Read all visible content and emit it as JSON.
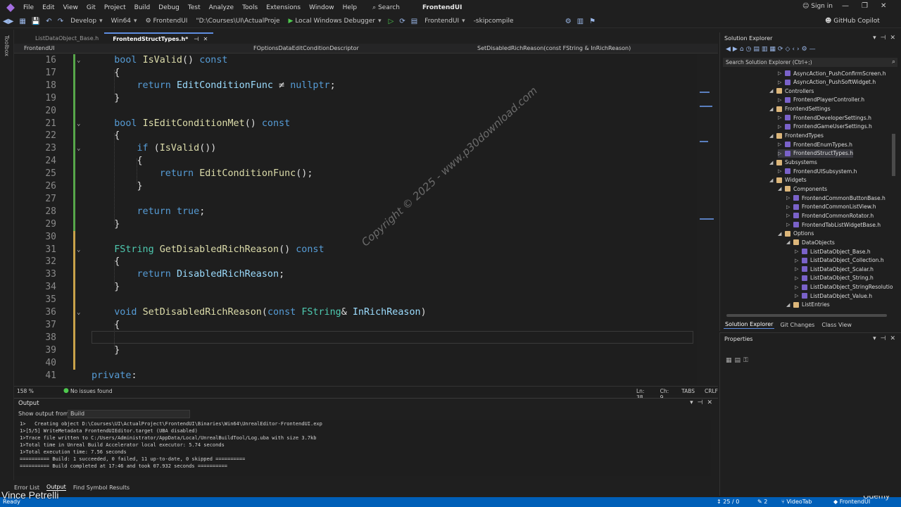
{
  "menu": {
    "items": [
      "File",
      "Edit",
      "View",
      "Git",
      "Project",
      "Build",
      "Debug",
      "Test",
      "Analyze",
      "Tools",
      "Extensions",
      "Window",
      "Help"
    ],
    "search_label": "Search",
    "solution_name": "FrontendUI",
    "sign_in": "Sign in"
  },
  "toolbar": {
    "config": "Develop",
    "platform": "Win64",
    "startup_project": "FrontendUI",
    "path": "\"D:\\Courses\\UI\\ActualProje",
    "debugger": "Local Windows Debugger",
    "target": "FrontendUI",
    "args": "-skipcompile",
    "copilot": "GitHub Copilot"
  },
  "toolbox_label": "Toolbox",
  "tabs": [
    {
      "label": "ListDataObject_Base.h",
      "active": false
    },
    {
      "label": "FrontendStructTypes.h*",
      "active": true
    }
  ],
  "navbar": {
    "project": "FrontendUI",
    "scope": "FOptionsDataEditConditionDescriptor",
    "member": "SetDisabledRichReason(const FString & InRichReason)"
  },
  "code_lines": [
    {
      "n": "16",
      "html": "    <span class=\"kw\">bool</span> <span class=\"fn\">IsValid</span>() <span class=\"kw\">const</span>",
      "fold": "⌄",
      "chg": "g"
    },
    {
      "n": "17",
      "html": "    {",
      "chg": "g"
    },
    {
      "n": "18",
      "html": "        <span class=\"kw\">return</span> <span class=\"pm\">EditConditionFunc</span> ≠ <span class=\"kw\">nullptr</span>;",
      "chg": "g"
    },
    {
      "n": "19",
      "html": "    }",
      "chg": "g"
    },
    {
      "n": "20",
      "html": "",
      "chg": "g"
    },
    {
      "n": "21",
      "html": "    <span class=\"kw\">bool</span> <span class=\"fn\">IsEditConditionMet</span>() <span class=\"kw\">const</span>",
      "fold": "⌄",
      "chg": "g"
    },
    {
      "n": "22",
      "html": "    {",
      "chg": "g"
    },
    {
      "n": "23",
      "html": "        <span class=\"kw\">if</span> (<span class=\"fn\">IsValid</span>())",
      "fold": "⌄",
      "chg": "g"
    },
    {
      "n": "24",
      "html": "        {",
      "chg": "g"
    },
    {
      "n": "25",
      "html": "            <span class=\"kw\">return</span> <span class=\"fn\">EditConditionFunc</span>();",
      "chg": "g"
    },
    {
      "n": "26",
      "html": "        }",
      "chg": "g"
    },
    {
      "n": "27",
      "html": "",
      "chg": "g"
    },
    {
      "n": "28",
      "html": "        <span class=\"kw\">return</span> <span class=\"kw\">true</span>;",
      "chg": "g"
    },
    {
      "n": "29",
      "html": "    }",
      "chg": "g"
    },
    {
      "n": "30",
      "html": "",
      "chg": "y"
    },
    {
      "n": "31",
      "html": "    <span class=\"ty\">FString</span> <span class=\"fn\">GetDisabledRichReason</span>() <span class=\"kw\">const</span>",
      "fold": "⌄",
      "chg": "y"
    },
    {
      "n": "32",
      "html": "    {",
      "chg": "y"
    },
    {
      "n": "33",
      "html": "        <span class=\"kw\">return</span> <span class=\"pm\">DisabledRichReason</span>;",
      "chg": "y"
    },
    {
      "n": "34",
      "html": "    }",
      "chg": "y"
    },
    {
      "n": "35",
      "html": "",
      "chg": "y"
    },
    {
      "n": "36",
      "html": "    <span class=\"kw\">void</span> <span class=\"fn\">SetDisabledRichReason</span>(<span class=\"kw\">const</span> <span class=\"ty\">FString</span>&amp; <span class=\"pm\">InRichReason</span>)",
      "fold": "⌄",
      "chg": "y"
    },
    {
      "n": "37",
      "html": "    {",
      "chg": "y"
    },
    {
      "n": "38",
      "html": "",
      "chg": "y"
    },
    {
      "n": "39",
      "html": "    }",
      "chg": "y"
    },
    {
      "n": "40",
      "html": "",
      "chg": "y"
    },
    {
      "n": "41",
      "html": "<span class=\"kw\">private</span>:",
      "chg": ""
    }
  ],
  "watermark": "Copyright © 2025 - www.p30download.com",
  "editor_status": {
    "zoom": "158 %",
    "issues": "No issues found",
    "ln": "Ln: 38",
    "ch": "Ch: 9",
    "tabs": "TABS",
    "eol": "CRLF"
  },
  "output": {
    "title": "Output",
    "show_from_label": "Show output from:",
    "show_from_value": "Build",
    "lines": [
      "1>   Creating object D:\\Courses\\UI\\ActualProject\\FrontendUI\\Binaries\\Win64\\UnrealEditor-FrontendUI.exp",
      "1>[5/5] WriteMetadata FrontendUIEditor.target (UBA disabled)",
      "1>Trace file written to C:/Users/Administrator/AppData/Local/UnrealBuildTool/Log.uba with size 3.7kb",
      "1>Total time in Unreal Build Accelerator local executor: 5.74 seconds",
      "1>Total execution time: 7.56 seconds",
      "========== Build: 1 succeeded, 0 failed, 11 up-to-date, 0 skipped ==========",
      "========== Build completed at 17:46 and took 07.932 seconds =========="
    ]
  },
  "bottom_tabs": [
    "Error List",
    "Output",
    "Find Symbol Results"
  ],
  "status": {
    "ready": "Ready",
    "lines": "25 / 0",
    "changes": "2",
    "branch": "VideoTab",
    "repo": "FrontendUI"
  },
  "author": "Vince Petrelli",
  "udemy": "Udemy",
  "solution_explorer": {
    "title": "Solution Explorer",
    "search_placeholder": "Search Solution Explorer (Ctrl+;)",
    "nodes": [
      {
        "label": "AsyncAction_PushConfirmScreen.h",
        "level": 7,
        "type": "h",
        "ar": "▷"
      },
      {
        "label": "AsyncAction_PushSoftWidget.h",
        "level": 7,
        "type": "h",
        "ar": "▷"
      },
      {
        "label": "Controllers",
        "level": 6,
        "type": "folder",
        "ar": "◢"
      },
      {
        "label": "FrontendPlayerController.h",
        "level": 7,
        "type": "h",
        "ar": "▷"
      },
      {
        "label": "FrontendSettings",
        "level": 6,
        "type": "folder",
        "ar": "◢"
      },
      {
        "label": "FrontendDeveloperSettings.h",
        "level": 7,
        "type": "h",
        "ar": "▷"
      },
      {
        "label": "FrontendGameUserSettings.h",
        "level": 7,
        "type": "h",
        "ar": "▷"
      },
      {
        "label": "FrontendTypes",
        "level": 6,
        "type": "folder",
        "ar": "◢"
      },
      {
        "label": "FrontendEnumTypes.h",
        "level": 7,
        "type": "h",
        "ar": "▷"
      },
      {
        "label": "FrontendStructTypes.h",
        "level": 7,
        "type": "h",
        "ar": "▷",
        "sel": true
      },
      {
        "label": "Subsystems",
        "level": 6,
        "type": "folder",
        "ar": "◢"
      },
      {
        "label": "FrontendUISubsystem.h",
        "level": 7,
        "type": "h",
        "ar": "▷"
      },
      {
        "label": "Widgets",
        "level": 6,
        "type": "folder",
        "ar": "◢"
      },
      {
        "label": "Components",
        "level": 7,
        "type": "folder",
        "ar": "◢"
      },
      {
        "label": "FrontendCommonButtonBase.h",
        "level": 8,
        "type": "h",
        "ar": "▷"
      },
      {
        "label": "FrontendCommonListView.h",
        "level": 8,
        "type": "h",
        "ar": "▷"
      },
      {
        "label": "FrontendCommonRotator.h",
        "level": 8,
        "type": "h",
        "ar": "▷"
      },
      {
        "label": "FrontendTabListWidgetBase.h",
        "level": 8,
        "type": "h",
        "ar": "▷"
      },
      {
        "label": "Options",
        "level": 7,
        "type": "folder",
        "ar": "◢"
      },
      {
        "label": "DataObjects",
        "level": 8,
        "type": "folder",
        "ar": "◢"
      },
      {
        "label": "ListDataObject_Base.h",
        "level": 9,
        "type": "h",
        "ar": "▷"
      },
      {
        "label": "ListDataObject_Collection.h",
        "level": 9,
        "type": "h",
        "ar": "▷"
      },
      {
        "label": "ListDataObject_Scalar.h",
        "level": 9,
        "type": "h",
        "ar": "▷"
      },
      {
        "label": "ListDataObject_String.h",
        "level": 9,
        "type": "h",
        "ar": "▷"
      },
      {
        "label": "ListDataObject_StringResolutio",
        "level": 9,
        "type": "h",
        "ar": "▷"
      },
      {
        "label": "ListDataObject_Value.h",
        "level": 9,
        "type": "h",
        "ar": "▷"
      },
      {
        "label": "ListEntries",
        "level": 8,
        "type": "folder",
        "ar": "◢"
      }
    ],
    "tabs": [
      "Solution Explorer",
      "Git Changes",
      "Class View"
    ]
  },
  "properties": {
    "title": "Properties"
  }
}
